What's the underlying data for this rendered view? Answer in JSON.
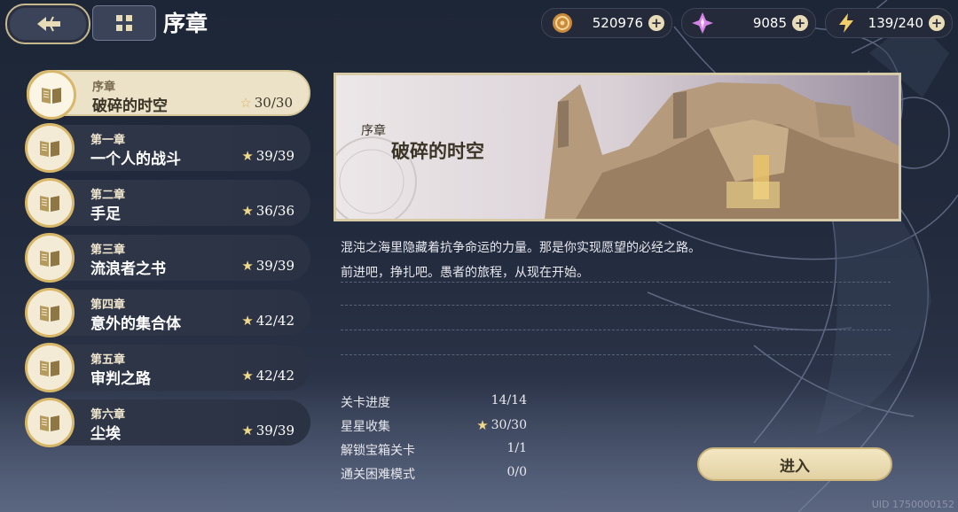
{
  "header": {
    "title": "序章"
  },
  "resources": [
    {
      "icon": "coin-icon",
      "value": "520976"
    },
    {
      "icon": "crystal-icon",
      "value": "9085"
    },
    {
      "icon": "energy-icon",
      "value": "139/240"
    }
  ],
  "chapters": [
    {
      "sub": "序章",
      "name": "破碎的时空",
      "stars": "30/30",
      "active": true
    },
    {
      "sub": "第一章",
      "name": "一个人的战斗",
      "stars": "39/39"
    },
    {
      "sub": "第二章",
      "name": "手足",
      "stars": "36/36"
    },
    {
      "sub": "第三章",
      "name": "流浪者之书",
      "stars": "39/39"
    },
    {
      "sub": "第四章",
      "name": "意外的集合体",
      "stars": "42/42"
    },
    {
      "sub": "第五章",
      "name": "审判之路",
      "stars": "42/42"
    },
    {
      "sub": "第六章",
      "name": "尘埃",
      "stars": "39/39"
    }
  ],
  "banner": {
    "sub": "序章",
    "title": "破碎的时空"
  },
  "description": {
    "line1": "混沌之海里隐藏着抗争命运的力量。那是你实现愿望的必经之路。",
    "line2": "前进吧，挣扎吧。愚者的旅程，从现在开始。"
  },
  "stats": [
    {
      "label": "关卡进度",
      "value": "14/14"
    },
    {
      "label": "星星收集",
      "value": "30/30",
      "star": true
    },
    {
      "label": "解锁宝箱关卡",
      "value": "1/1"
    },
    {
      "label": "通关困难模式",
      "value": "0/0"
    }
  ],
  "enter_label": "进入",
  "uid": "UID 1750000152",
  "colors": {
    "gold": "#d8b768",
    "panel_light": "#ece2c8",
    "bg_dark": "#1d2637",
    "star": "#f1d98a"
  }
}
